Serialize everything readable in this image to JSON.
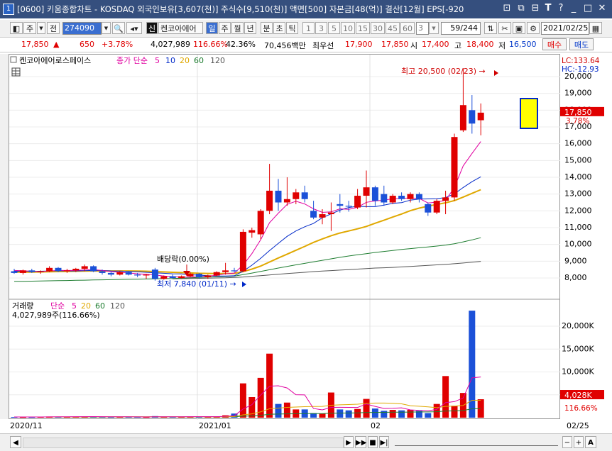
{
  "titlebar": {
    "index": "1",
    "text": "[0600] 키움종합차트 - KOSDAQ 외국인보유[3,607(천)] 주식수[9,510(천)] 액면[500] 자본금[48(억)] 결산[12월] EPS[-920"
  },
  "toolbar": {
    "period_label": "주",
    "prev_label": "전",
    "code_value": "274090",
    "credit_label": "신",
    "stock_name": "켄코아에어",
    "tabs": [
      "일",
      "주",
      "월",
      "년",
      "분",
      "초",
      "틱"
    ],
    "intervals": [
      "1",
      "3",
      "5",
      "10",
      "15",
      "30",
      "45",
      "60"
    ],
    "spinner_value": "3",
    "page_count": "59/244",
    "date_value": "2021/02/25"
  },
  "quote": {
    "price": "17,850",
    "change": "650",
    "change_pct": "+3.78%",
    "volume": "4,027,989",
    "vol_ratio": "116.66%",
    "turnover": "42.36%",
    "amount": "70,456백만",
    "best_ask_label": "최우선",
    "best_ask1": "17,900",
    "best_ask2": "17,850",
    "open_label": "시",
    "open": "17,400",
    "high_label": "고",
    "high": "18,400",
    "low_label": "저",
    "low": "16,500",
    "buy_label": "매수",
    "sell_label": "매도"
  },
  "price_panel": {
    "stock_label": "켄코아에어로스페이스",
    "ma_title": "종가 단순",
    "ma_periods": [
      "5",
      "10",
      "20",
      "60",
      "120"
    ],
    "lc_label": "LC:133.64",
    "hc_label": "HC:-12.93",
    "high_annot": "최고 20,500 (02/23) →",
    "dividend_annot": "배당락(0.00%)",
    "low_annot": "최저 7,840 (01/11) →",
    "current_price": "17,850",
    "current_pct": "3.78%",
    "yticks": [
      20000,
      19000,
      18000,
      17000,
      16000,
      15000,
      14000,
      13000,
      12000,
      11000,
      10000,
      9000,
      8000
    ],
    "ytick_labels": [
      "20,000",
      "19,000",
      "18,000",
      "17,000",
      "16,000",
      "15,000",
      "14,000",
      "13,000",
      "12,000",
      "11,000",
      "10,000",
      "9,000",
      "8,000"
    ]
  },
  "volume_panel": {
    "title": "거래량",
    "ma_title": "단순",
    "ma_periods": [
      "5",
      "20",
      "60",
      "120"
    ],
    "current_text": "4,027,989주(116.66%)",
    "yticks": [
      20000,
      15000,
      10000,
      5000
    ],
    "ytick_labels": [
      "20,000K",
      "15,000K",
      "10,000K",
      "5,000K"
    ],
    "current_value": "4,028K",
    "current_pct": "116.66%"
  },
  "date_axis": {
    "labels": [
      "2020/11",
      "2021/01",
      "02",
      "02/25"
    ]
  },
  "colors": {
    "up": "#e00000",
    "down": "#1b50d8",
    "ma5": "#e000a0",
    "ma10": "#0028c8",
    "ma20": "#e0a800",
    "ma60": "#1e7d30",
    "ma120": "#555555"
  },
  "chart_data": {
    "type": "candlestick",
    "candles": [
      {
        "o": 8400,
        "h": 8550,
        "l": 8250,
        "c": 8300
      },
      {
        "o": 8300,
        "h": 8500,
        "l": 8200,
        "c": 8450
      },
      {
        "o": 8450,
        "h": 8550,
        "l": 8300,
        "c": 8350
      },
      {
        "o": 8350,
        "h": 8450,
        "l": 8250,
        "c": 8400
      },
      {
        "o": 8400,
        "h": 8700,
        "l": 8350,
        "c": 8600
      },
      {
        "o": 8600,
        "h": 8650,
        "l": 8350,
        "c": 8400
      },
      {
        "o": 8400,
        "h": 8550,
        "l": 8300,
        "c": 8450
      },
      {
        "o": 8450,
        "h": 8600,
        "l": 8350,
        "c": 8550
      },
      {
        "o": 8550,
        "h": 8800,
        "l": 8400,
        "c": 8700
      },
      {
        "o": 8700,
        "h": 8750,
        "l": 8350,
        "c": 8400
      },
      {
        "o": 8400,
        "h": 8500,
        "l": 8200,
        "c": 8300
      },
      {
        "o": 8300,
        "h": 8350,
        "l": 8100,
        "c": 8200
      },
      {
        "o": 8200,
        "h": 8400,
        "l": 8150,
        "c": 8350
      },
      {
        "o": 8350,
        "h": 8400,
        "l": 8150,
        "c": 8200
      },
      {
        "o": 8200,
        "h": 8300,
        "l": 8050,
        "c": 8150
      },
      {
        "o": 8150,
        "h": 8250,
        "l": 7950,
        "c": 8200
      },
      {
        "o": 8500,
        "h": 8600,
        "l": 7840,
        "c": 7950
      },
      {
        "o": 7950,
        "h": 8150,
        "l": 7900,
        "c": 8100
      },
      {
        "o": 8100,
        "h": 8200,
        "l": 7950,
        "c": 8000
      },
      {
        "o": 8000,
        "h": 8150,
        "l": 7950,
        "c": 8100
      },
      {
        "o": 8100,
        "h": 8350,
        "l": 8050,
        "c": 8250
      },
      {
        "o": 8250,
        "h": 8300,
        "l": 7950,
        "c": 8050
      },
      {
        "o": 8050,
        "h": 8200,
        "l": 7950,
        "c": 8150
      },
      {
        "o": 8150,
        "h": 8400,
        "l": 8100,
        "c": 8350
      },
      {
        "o": 8350,
        "h": 8900,
        "l": 8200,
        "c": 8450
      },
      {
        "o": 8450,
        "h": 8600,
        "l": 8350,
        "c": 8400
      },
      {
        "o": 8400,
        "h": 10900,
        "l": 8350,
        "c": 10750
      },
      {
        "o": 10700,
        "h": 11000,
        "l": 10400,
        "c": 10850
      },
      {
        "o": 10600,
        "h": 12100,
        "l": 10300,
        "c": 12000
      },
      {
        "o": 12000,
        "h": 14800,
        "l": 11800,
        "c": 13200
      },
      {
        "o": 13200,
        "h": 13900,
        "l": 12000,
        "c": 12500
      },
      {
        "o": 12500,
        "h": 14000,
        "l": 12300,
        "c": 12700
      },
      {
        "o": 12700,
        "h": 13300,
        "l": 12400,
        "c": 13100
      },
      {
        "o": 13100,
        "h": 13500,
        "l": 12500,
        "c": 12700
      },
      {
        "o": 12000,
        "h": 12600,
        "l": 11500,
        "c": 11600
      },
      {
        "o": 11600,
        "h": 12100,
        "l": 11200,
        "c": 11800
      },
      {
        "o": 11800,
        "h": 12500,
        "l": 10800,
        "c": 11900
      },
      {
        "o": 12400,
        "h": 13000,
        "l": 11900,
        "c": 12300
      },
      {
        "o": 12300,
        "h": 12600,
        "l": 11950,
        "c": 12250
      },
      {
        "o": 12200,
        "h": 13300,
        "l": 12100,
        "c": 12900
      },
      {
        "o": 12900,
        "h": 14400,
        "l": 12200,
        "c": 13400
      },
      {
        "o": 13400,
        "h": 13500,
        "l": 12300,
        "c": 12600
      },
      {
        "o": 13000,
        "h": 13500,
        "l": 12300,
        "c": 12500
      },
      {
        "o": 12500,
        "h": 13000,
        "l": 12400,
        "c": 12900
      },
      {
        "o": 12900,
        "h": 13100,
        "l": 12600,
        "c": 12700
      },
      {
        "o": 12700,
        "h": 13100,
        "l": 12500,
        "c": 13000
      },
      {
        "o": 13000,
        "h": 13100,
        "l": 12500,
        "c": 12700
      },
      {
        "o": 12400,
        "h": 12500,
        "l": 11700,
        "c": 11900
      },
      {
        "o": 11900,
        "h": 12700,
        "l": 11800,
        "c": 12600
      },
      {
        "o": 12600,
        "h": 13200,
        "l": 11800,
        "c": 12800
      },
      {
        "o": 12800,
        "h": 16600,
        "l": 12600,
        "c": 16400
      },
      {
        "o": 16800,
        "h": 20500,
        "l": 16700,
        "c": 18300
      },
      {
        "o": 18000,
        "h": 18900,
        "l": 16600,
        "c": 17200
      },
      {
        "o": 17400,
        "h": 18400,
        "l": 16500,
        "c": 17850
      }
    ],
    "volumes": [
      150,
      120,
      130,
      180,
      250,
      200,
      150,
      180,
      260,
      220,
      160,
      140,
      180,
      170,
      150,
      130,
      340,
      200,
      180,
      160,
      190,
      220,
      200,
      260,
      520,
      900,
      7500,
      4500,
      8700,
      14000,
      3000,
      3300,
      1800,
      1800,
      1000,
      900,
      5500,
      1800,
      1600,
      1900,
      4100,
      2000,
      1500,
      1700,
      1600,
      1700,
      1500,
      1000,
      3000,
      9100,
      2600,
      5400,
      23400,
      4028
    ],
    "ma5": [
      8450,
      8430,
      8400,
      8380,
      8420,
      8450,
      8450,
      8450,
      8480,
      8500,
      8450,
      8380,
      8340,
      8300,
      8250,
      8220,
      8180,
      8120,
      8080,
      8060,
      8050,
      8080,
      8110,
      8160,
      8250,
      8290,
      8770,
      9450,
      10280,
      11290,
      11860,
      12380,
      12570,
      12410,
      12120,
      11910,
      11940,
      12120,
      12090,
      12210,
      12510,
      12590,
      12640,
      12720,
      12740,
      12770,
      12740,
      12470,
      12520,
      12630,
      13390,
      14680,
      15420,
      16130
    ],
    "ma10": [
      8400,
      8400,
      8400,
      8400,
      8420,
      8430,
      8420,
      8420,
      8430,
      8450,
      8450,
      8420,
      8410,
      8390,
      8370,
      8340,
      8310,
      8280,
      8250,
      8240,
      8190,
      8170,
      8140,
      8120,
      8120,
      8130,
      8400,
      8760,
      9170,
      9630,
      10060,
      10480,
      10800,
      11050,
      11250,
      11590,
      11820,
      12040,
      12200,
      12270,
      12250,
      12250,
      12340,
      12450,
      12490,
      12640,
      12700,
      12710,
      12730,
      12790,
      13010,
      13390,
      13740,
      14030
    ],
    "ma20": [
      8350,
      8350,
      8350,
      8360,
      8370,
      8380,
      8390,
      8400,
      8410,
      8420,
      8420,
      8420,
      8420,
      8420,
      8410,
      8400,
      8380,
      8360,
      8340,
      8320,
      8300,
      8280,
      8270,
      8260,
      8260,
      8270,
      8380,
      8530,
      8710,
      8950,
      9190,
      9420,
      9650,
      9880,
      10120,
      10330,
      10520,
      10680,
      10800,
      10930,
      11070,
      11260,
      11440,
      11630,
      11810,
      12010,
      12160,
      12280,
      12380,
      12480,
      12610,
      12820,
      13040,
      13260
    ],
    "ma60": [
      7800,
      7800,
      7810,
      7820,
      7830,
      7840,
      7850,
      7860,
      7870,
      7880,
      7890,
      7900,
      7910,
      7920,
      7930,
      7940,
      7950,
      7960,
      7970,
      7990,
      8010,
      8030,
      8050,
      8070,
      8090,
      8110,
      8200,
      8290,
      8390,
      8490,
      8590,
      8690,
      8780,
      8870,
      8960,
      9050,
      9140,
      9230,
      9310,
      9380,
      9450,
      9520,
      9580,
      9640,
      9700,
      9750,
      9800,
      9850,
      9900,
      9960,
      10040,
      10150,
      10270,
      10400
    ],
    "ma120": [
      null,
      null,
      null,
      null,
      null,
      null,
      null,
      null,
      null,
      null,
      null,
      null,
      null,
      null,
      null,
      null,
      null,
      null,
      7950,
      7960,
      7970,
      7980,
      7990,
      8000,
      8010,
      8030,
      8060,
      8100,
      8140,
      8180,
      8220,
      8260,
      8300,
      8340,
      8380,
      8410,
      8440,
      8470,
      8500,
      8530,
      8560,
      8590,
      8610,
      8630,
      8660,
      8690,
      8720,
      8750,
      8780,
      8810,
      8850,
      8890,
      8940,
      8990
    ],
    "vol_ma5": [
      160,
      150,
      150,
      160,
      170,
      190,
      200,
      210,
      220,
      230,
      210,
      190,
      180,
      180,
      170,
      160,
      190,
      190,
      190,
      180,
      210,
      220,
      210,
      220,
      300,
      430,
      1890,
      2840,
      4940,
      6880,
      6980,
      6500,
      5020,
      4980,
      2000,
      1700,
      2250,
      2260,
      2250,
      2240,
      2980,
      2470,
      2020,
      2040,
      2160,
      1700,
      1580,
      1500,
      1800,
      3300,
      3500,
      4300,
      8700,
      8900
    ],
    "vol_ma20": [
      160,
      160,
      160,
      160,
      160,
      165,
      170,
      175,
      180,
      185,
      185,
      185,
      185,
      185,
      180,
      180,
      185,
      185,
      185,
      185,
      190,
      190,
      190,
      200,
      210,
      250,
      620,
      840,
      1270,
      1960,
      2100,
      2250,
      2320,
      2400,
      2440,
      2470,
      2720,
      2800,
      2870,
      2950,
      3120,
      3200,
      3190,
      3170,
      3030,
      2620,
      2500,
      2350,
      2180,
      2460,
      2550,
      2680,
      3800,
      3800
    ],
    "vol_ma60": [
      150,
      150,
      150,
      150,
      150,
      150,
      155,
      155,
      160,
      160,
      160,
      165,
      165,
      165,
      165,
      170,
      170,
      170,
      170,
      175,
      175,
      175,
      180,
      185,
      190,
      200,
      320,
      390,
      520,
      740,
      790,
      840,
      860,
      880,
      890,
      900,
      980,
      1010,
      1030,
      1060,
      1120,
      1150,
      1170,
      1190,
      1210,
      1230,
      1250,
      1260,
      1310,
      1450,
      1490,
      1570,
      1940,
      1990
    ]
  }
}
